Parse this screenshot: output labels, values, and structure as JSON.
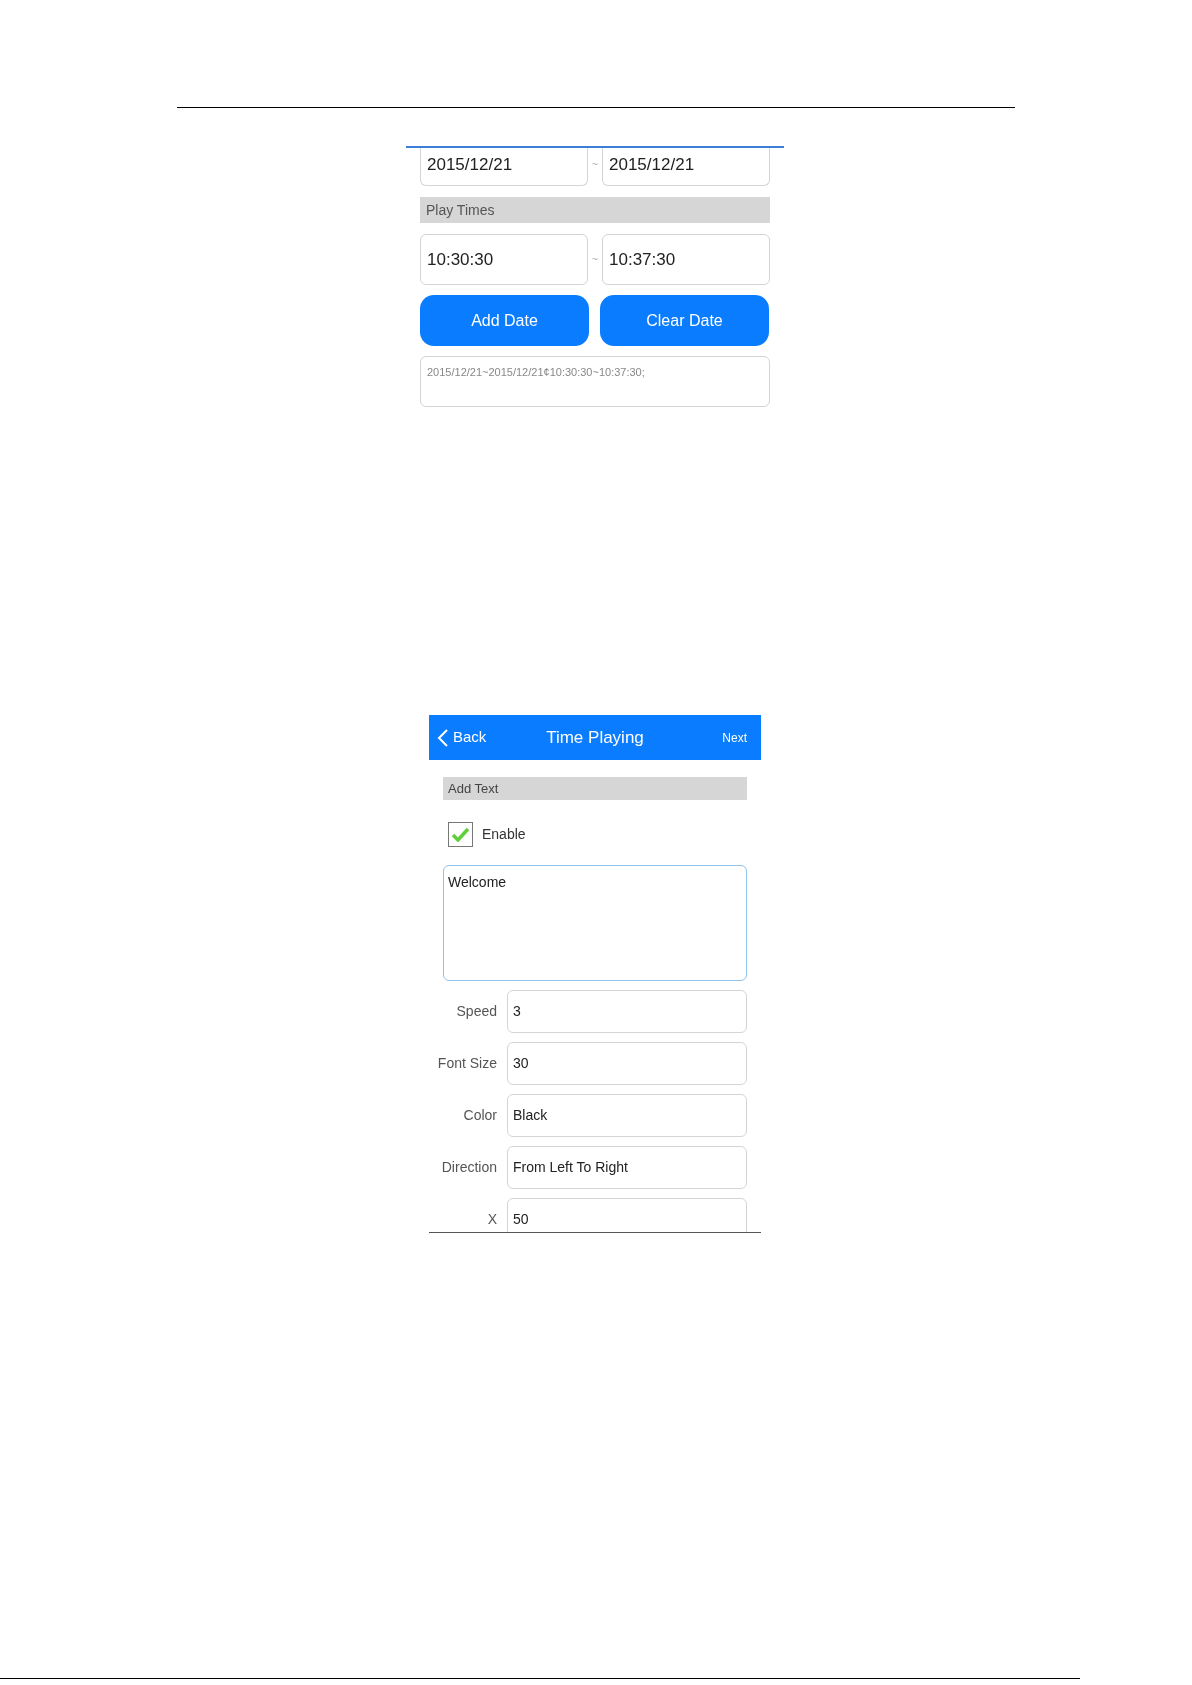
{
  "date_screen": {
    "date_range": {
      "start": "2015/12/21",
      "separator": "~",
      "end": "2015/12/21"
    },
    "section_title": "Play Times",
    "time_range": {
      "start": "10:30:30",
      "separator": "~",
      "end": "10:37:30"
    },
    "buttons": [
      "Add Date",
      "Clear Date"
    ],
    "schedule_list": "2015/12/21~2015/12/21¢10:30:30~10:37:30;"
  },
  "text_screen": {
    "nav": {
      "back": "Back",
      "title": "Time Playing",
      "next": "Next"
    },
    "section_title": "Add Text",
    "enable": {
      "label": "Enable",
      "checked": true
    },
    "text_value": "Welcome",
    "fields": [
      {
        "label": "Speed",
        "value": "3"
      },
      {
        "label": "Font Size",
        "value": "30"
      },
      {
        "label": "Color",
        "value": "Black"
      },
      {
        "label": "Direction",
        "value": "From Left To Right"
      },
      {
        "label": "X",
        "value": "50"
      }
    ]
  }
}
